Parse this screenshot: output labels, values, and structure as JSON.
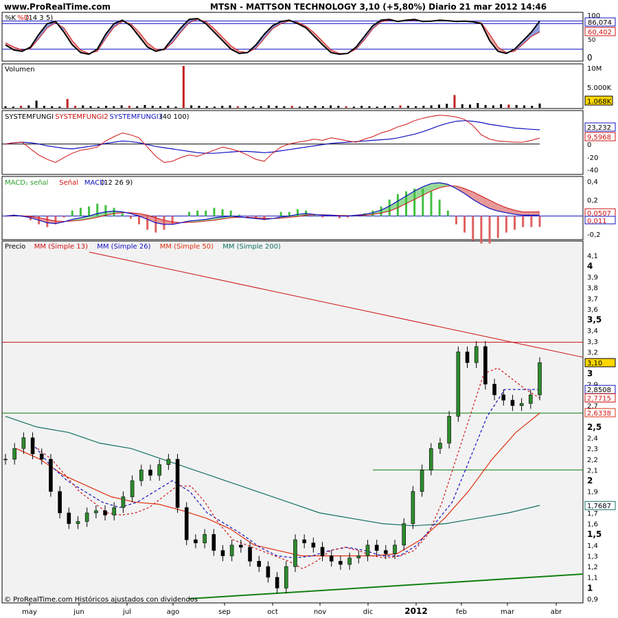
{
  "header": {
    "site": "www.ProRealTime.com",
    "title": "MTSN - MATTSON TECHNOLOGY    3,10 (+5,80%)    Diario  21 mar 2012 14:46"
  },
  "footer": {
    "note": "© ProRealTime.com  Históricos ajustados con dividendos"
  },
  "months": [
    "may",
    "jun",
    "jul",
    "ago",
    "sep",
    "oct",
    "nov",
    "dic",
    "2012",
    "feb",
    "mar",
    "abr"
  ],
  "colors": {
    "border": "#000000",
    "panel_bg": "#ffffff",
    "price_bg": "#f2f2f2",
    "up": "#2e8b2e",
    "down": "#000000",
    "ma13": "#d01010",
    "ma26": "#1010c0",
    "ma50": "#e03010",
    "ma200": "#107060",
    "trend_red": "#cc1010",
    "support_green": "#108010",
    "macd_pos": "#40c040",
    "macd_neg": "#e06060",
    "badge_yellow": "#ffd700"
  },
  "chart_data": [
    {
      "type": "line",
      "panel": "stochastic",
      "title": "%K %D (14 3 5)",
      "title_parts": [
        {
          "text": "%K ",
          "color": "#000000"
        },
        {
          "text": "%D",
          "color": "#d01010"
        },
        {
          "text": " (14 3 5)",
          "color": "#000000"
        }
      ],
      "ylim": [
        0,
        100
      ],
      "y_tick_labels": [
        "100",
        "86,074",
        "60,402",
        "50",
        "0"
      ],
      "reference_lines": [
        20,
        80
      ],
      "series": [
        {
          "name": "%K",
          "values": [
            30,
            18,
            15,
            25,
            55,
            80,
            85,
            60,
            30,
            12,
            8,
            20,
            55,
            80,
            88,
            75,
            50,
            25,
            15,
            20,
            45,
            70,
            90,
            92,
            80,
            60,
            40,
            20,
            10,
            12,
            30,
            55,
            75,
            85,
            88,
            80,
            70,
            50,
            30,
            12,
            8,
            10,
            25,
            50,
            75,
            88,
            90,
            85,
            88,
            90,
            85,
            86,
            88,
            87,
            85,
            86,
            84,
            80,
            40,
            15,
            10,
            20,
            40,
            60,
            86
          ]
        },
        {
          "name": "%D",
          "values": [
            35,
            25,
            18,
            22,
            45,
            70,
            82,
            70,
            40,
            18,
            10,
            15,
            45,
            72,
            85,
            80,
            60,
            35,
            20,
            18,
            35,
            60,
            82,
            90,
            85,
            68,
            48,
            28,
            15,
            12,
            22,
            45,
            68,
            80,
            86,
            83,
            74,
            58,
            38,
            18,
            10,
            10,
            20,
            42,
            68,
            84,
            88,
            86,
            87,
            88,
            86,
            86,
            87,
            87,
            86,
            86,
            85,
            82,
            55,
            25,
            12,
            15,
            32,
            50,
            60.4
          ]
        }
      ]
    },
    {
      "type": "bar",
      "panel": "volume",
      "title": "Volumen",
      "y_tick_labels": [
        "10M",
        "5.000K"
      ],
      "current_label": "1.068K",
      "values": [
        0.4,
        0.3,
        0.5,
        0.6,
        1.8,
        0.5,
        0.4,
        0.3,
        2.2,
        0.5,
        0.6,
        0.4,
        0.3,
        0.5,
        0.4,
        0.6,
        0.5,
        0.4,
        0.7,
        0.5,
        0.4,
        0.5,
        0.3,
        10.5,
        0.6,
        0.5,
        0.4,
        0.3,
        0.5,
        0.6,
        0.4,
        0.5,
        0.3,
        0.4,
        0.6,
        0.5,
        0.4,
        0.5,
        0.3,
        0.4,
        0.5,
        0.4,
        0.6,
        0.5,
        0.4,
        0.3,
        0.5,
        0.4,
        0.3,
        0.5,
        0.4,
        0.6,
        0.5,
        0.4,
        0.5,
        0.6,
        0.8,
        1.0,
        3.2,
        0.9,
        0.8,
        1.2,
        0.7,
        0.6,
        0.9,
        0.8,
        0.7,
        0.6,
        0.5,
        1.068
      ]
    },
    {
      "type": "line",
      "panel": "systemfungi",
      "title": "SYSTEMFUNGI SYSTEMFUNGI2 SYSTEMFUNGI3 (40 100)",
      "title_parts": [
        {
          "text": "SYSTEMFUNGI ",
          "color": "#000000"
        },
        {
          "text": "SYSTEMFUNGI2 ",
          "color": "#d01010"
        },
        {
          "text": "SYSTEMFUNGI3",
          "color": "#1010c0"
        },
        {
          "text": " (40 100)",
          "color": "#000000"
        }
      ],
      "ylim": [
        -45,
        50
      ],
      "y_tick_labels": [
        "23,232",
        "9,5968",
        "0",
        "-20",
        "-40"
      ],
      "series": [
        {
          "name": "SYSTEMFUNGI2",
          "values": [
            0,
            2,
            3,
            -8,
            -18,
            -25,
            -30,
            -22,
            -15,
            -10,
            -8,
            -5,
            5,
            12,
            18,
            15,
            10,
            -5,
            -20,
            -30,
            -28,
            -22,
            -18,
            -20,
            -15,
            -10,
            -5,
            -8,
            -12,
            -18,
            -25,
            -28,
            -15,
            -5,
            0,
            3,
            5,
            8,
            6,
            10,
            8,
            5,
            3,
            8,
            12,
            18,
            22,
            28,
            32,
            38,
            42,
            45,
            47,
            46,
            44,
            40,
            30,
            15,
            8,
            5,
            4,
            3,
            3,
            6,
            9.6
          ]
        },
        {
          "name": "SYSTEMFUNGI3",
          "values": [
            0,
            2,
            3,
            2,
            0,
            -3,
            -5,
            -7,
            -8,
            -6,
            -4,
            -2,
            1,
            3,
            5,
            4,
            2,
            -1,
            -4,
            -6,
            -8,
            -10,
            -12,
            -14,
            -15,
            -15,
            -14,
            -13,
            -12,
            -12,
            -13,
            -14,
            -13,
            -11,
            -9,
            -7,
            -5,
            -3,
            -1,
            1,
            2,
            3,
            4,
            5,
            6,
            7,
            8,
            10,
            13,
            16,
            20,
            25,
            30,
            34,
            37,
            38,
            37,
            35,
            32,
            30,
            28,
            26,
            25,
            24,
            23.2
          ]
        }
      ]
    },
    {
      "type": "line",
      "panel": "macd",
      "title": "MACD-, señal Señal MACD (12 26 9)",
      "title_parts": [
        {
          "text": "MACD-",
          "color": "#2e9e2e"
        },
        {
          "text": ", señal ",
          "color": "#2e9e2e"
        },
        {
          "text": "Señal ",
          "color": "#d01010"
        },
        {
          "text": "MACD",
          "color": "#1010c0"
        },
        {
          "text": " (12 26 9)",
          "color": "#000000"
        }
      ],
      "ylim": [
        -0.25,
        0.45
      ],
      "y_tick_labels": [
        "0,4",
        "0,2",
        "0,0507",
        "0,011",
        "-0,2"
      ],
      "series": [
        {
          "name": "MACD",
          "values": [
            0.0,
            0.01,
            0.0,
            -0.02,
            -0.05,
            -0.08,
            -0.09,
            -0.07,
            -0.04,
            -0.02,
            0.0,
            0.03,
            0.05,
            0.06,
            0.05,
            0.03,
            0.0,
            -0.04,
            -0.08,
            -0.1,
            -0.1,
            -0.08,
            -0.06,
            -0.05,
            -0.04,
            -0.02,
            -0.01,
            0.0,
            -0.01,
            -0.02,
            -0.03,
            -0.04,
            -0.03,
            -0.01,
            0.0,
            0.02,
            0.03,
            0.02,
            0.01,
            0.01,
            0.0,
            0.0,
            0.01,
            0.02,
            0.04,
            0.07,
            0.12,
            0.18,
            0.24,
            0.3,
            0.35,
            0.39,
            0.4,
            0.38,
            0.33,
            0.27,
            0.2,
            0.14,
            0.09,
            0.06,
            0.04,
            0.02,
            0.01,
            0.01,
            0.011
          ]
        },
        {
          "name": "Señal",
          "values": [
            0.0,
            0.005,
            0.003,
            -0.005,
            -0.02,
            -0.04,
            -0.06,
            -0.065,
            -0.06,
            -0.05,
            -0.035,
            -0.015,
            0.01,
            0.03,
            0.04,
            0.04,
            0.03,
            0.01,
            -0.02,
            -0.05,
            -0.07,
            -0.08,
            -0.075,
            -0.07,
            -0.06,
            -0.05,
            -0.035,
            -0.02,
            -0.015,
            -0.015,
            -0.02,
            -0.025,
            -0.03,
            -0.025,
            -0.015,
            -0.005,
            0.01,
            0.015,
            0.015,
            0.012,
            0.008,
            0.005,
            0.006,
            0.01,
            0.02,
            0.035,
            0.06,
            0.1,
            0.15,
            0.2,
            0.25,
            0.3,
            0.34,
            0.36,
            0.36,
            0.33,
            0.29,
            0.24,
            0.19,
            0.14,
            0.1,
            0.07,
            0.05,
            0.05,
            0.0507
          ]
        }
      ]
    },
    {
      "type": "line",
      "panel": "price",
      "title": "Precio MM (Simple 13) MM (Simple 26) MM (Simple 50) MM (Simple 200)",
      "title_parts": [
        {
          "text": "Precio ",
          "color": "#000000"
        },
        {
          "text": "MM (Simple 13) ",
          "color": "#d01010"
        },
        {
          "text": "MM (Simple 26) ",
          "color": "#1010c0"
        },
        {
          "text": "MM (Simple 50) ",
          "color": "#e03010"
        },
        {
          "text": "MM (Simple 200)",
          "color": "#107060"
        }
      ],
      "ylim": [
        0.9,
        4.15
      ],
      "y_tick_labels": [
        "4,1",
        "4",
        "3,9",
        "3,8",
        "3,7",
        "3,6",
        "3,5",
        "3,4",
        "3,3",
        "3,2",
        "3",
        "2,9",
        "2,7",
        "2,5",
        "2,4",
        "2,3",
        "2,2",
        "2,1",
        "2",
        "1,9",
        "1,7",
        "1,6",
        "1,5",
        "1,4",
        "1,3",
        "1,2",
        "1,1",
        "1",
        "0,9"
      ],
      "value_badges": [
        {
          "label": "3,10",
          "kind": "price"
        },
        {
          "label": "2,8508",
          "kind": "ma26"
        },
        {
          "label": "2,7715",
          "kind": "ma13"
        },
        {
          "label": "2,6338",
          "kind": "ma50"
        },
        {
          "label": "1,7687",
          "kind": "ma200"
        }
      ],
      "horizontal_lines": [
        {
          "y": 3.29,
          "color": "red"
        },
        {
          "y": 2.63,
          "color": "green"
        },
        {
          "y": 2.1,
          "color": "green"
        }
      ],
      "trendlines": [
        {
          "points": [
            [
              0,
              4.2
            ],
            [
              72,
              3.15
            ]
          ],
          "color": "red"
        },
        {
          "points": [
            [
              0,
              0.88
            ],
            [
              72,
              1.13
            ]
          ],
          "color": "green"
        }
      ],
      "close": [
        2.2,
        2.3,
        2.4,
        2.25,
        2.2,
        1.9,
        1.7,
        1.6,
        1.62,
        1.7,
        1.72,
        1.68,
        1.75,
        1.85,
        2.0,
        2.1,
        2.05,
        2.15,
        2.2,
        1.75,
        1.45,
        1.42,
        1.5,
        1.35,
        1.3,
        1.4,
        1.38,
        1.25,
        1.2,
        1.1,
        1.0,
        1.2,
        1.45,
        1.42,
        1.38,
        1.3,
        1.25,
        1.22,
        1.28,
        1.3,
        1.4,
        1.35,
        1.32,
        1.4,
        1.6,
        1.9,
        2.1,
        2.3,
        2.35,
        2.6,
        3.2,
        3.1,
        3.25,
        2.9,
        2.8,
        2.75,
        2.7,
        2.72,
        2.8,
        3.1
      ],
      "ma13": [
        2.3,
        2.2,
        2.05,
        1.9,
        1.8,
        1.7,
        1.68,
        1.7,
        1.75,
        1.85,
        1.95,
        1.95,
        1.8,
        1.6,
        1.45,
        1.4,
        1.35,
        1.3,
        1.25,
        1.18,
        1.25,
        1.35,
        1.38,
        1.35,
        1.3,
        1.28,
        1.3,
        1.35,
        1.5,
        1.8,
        2.2,
        2.6,
        3.0,
        3.05,
        2.95,
        2.85,
        2.77
      ],
      "ma26": [
        2.35,
        2.15,
        2.0,
        1.9,
        1.8,
        1.75,
        1.8,
        1.9,
        2.0,
        1.9,
        1.7,
        1.6,
        1.5,
        1.38,
        1.3,
        1.28,
        1.3,
        1.35,
        1.38,
        1.35,
        1.3,
        1.3,
        1.4,
        1.6,
        1.8,
        2.2,
        2.6,
        2.85,
        2.85,
        2.85
      ],
      "ma50": [
        2.3,
        2.2,
        2.05,
        1.95,
        1.85,
        1.8,
        1.78,
        1.72,
        1.65,
        1.55,
        1.4,
        1.35,
        1.3,
        1.3,
        1.3,
        1.3,
        1.32,
        1.45,
        1.65,
        1.9,
        2.2,
        2.45,
        2.63
      ],
      "ma200": [
        2.6,
        2.5,
        2.45,
        2.35,
        2.3,
        2.2,
        2.1,
        2.0,
        1.9,
        1.8,
        1.7,
        1.65,
        1.6,
        1.58,
        1.6,
        1.65,
        1.7,
        1.77
      ]
    }
  ]
}
